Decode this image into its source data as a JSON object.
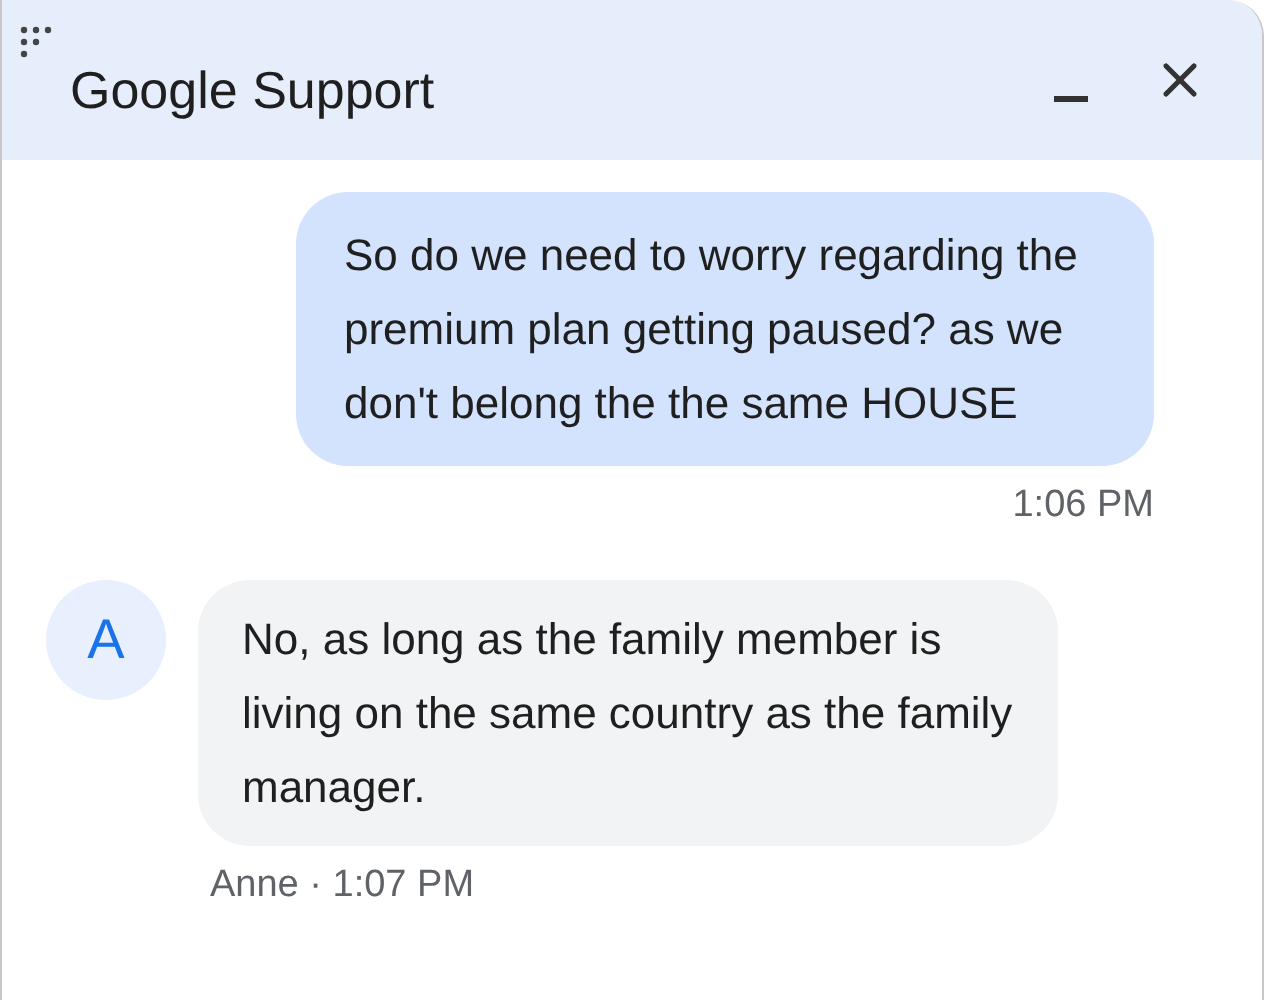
{
  "window": {
    "title": "Google Support"
  },
  "messages": [
    {
      "kind": "sent",
      "text": "So do we need to worry regarding the premium plan getting paused? as we don't belong the the same HOUSE",
      "meta": "1:06 PM"
    },
    {
      "kind": "received",
      "avatar": "A",
      "text": "No, as long as the family member is living on the same country as the family manager.",
      "meta": "Anne · 1:07 PM"
    }
  ]
}
